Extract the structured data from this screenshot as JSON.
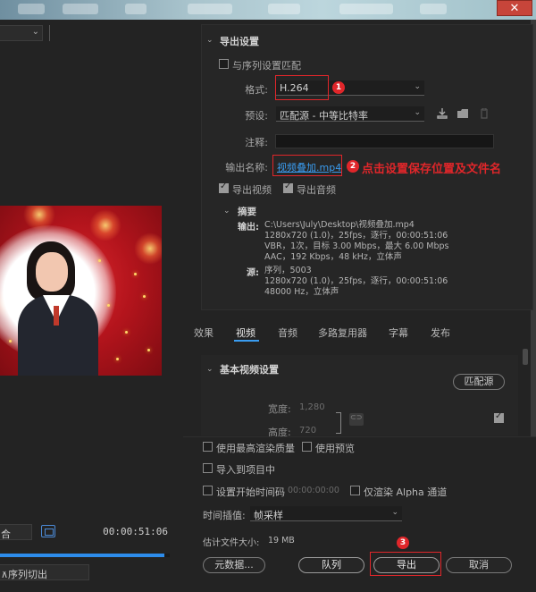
{
  "window": {
    "close_glyph": "✕"
  },
  "left_panel": {
    "fit_dropdown": "合",
    "timecode": "00:00:51:06",
    "progress_fraction": 0.97,
    "range_dropdown": "∧序列切出"
  },
  "export_settings": {
    "section_title": "导出设置",
    "match_sequence_label": "与序列设置匹配",
    "format_label": "格式:",
    "format_value": "H.264",
    "preset_label": "预设:",
    "preset_value": "匹配源 - 中等比特率",
    "comment_label": "注释:",
    "output_name_label": "输出名称:",
    "output_name_value": "视频叠加.mp4",
    "export_video_label": "导出视频",
    "export_audio_label": "导出音频"
  },
  "summary": {
    "title": "摘要",
    "output_key": "输出:",
    "output_lines": [
      "C:\\Users\\July\\Desktop\\视频叠加.mp4",
      "1280x720 (1.0)，25fps，逐行，00:00:51:06",
      "VBR，1次，目标 3.00 Mbps，最大 6.00 Mbps",
      "AAC，192 Kbps，48  kHz，立体声"
    ],
    "source_key": "源:",
    "source_lines": [
      "序列，5003",
      "1280x720 (1.0)，25fps，逐行，00:00:51:06",
      "48000 Hz，立体声"
    ]
  },
  "tabs": [
    "效果",
    "视频",
    "音频",
    "多路复用器",
    "字幕",
    "发布"
  ],
  "video": {
    "section_title": "基本视频设置",
    "match_source_button": "匹配源",
    "width_label": "宽度:",
    "width_value": "1,280",
    "height_label": "高度:",
    "height_value": "720"
  },
  "options": {
    "max_render_quality": "使用最高渲染质量",
    "use_previews": "使用预览",
    "import_into_project": "导入到项目中",
    "set_start_timecode": "设置开始时间码",
    "start_timecode_value": "00:00:00:00",
    "render_alpha_only": "仅渲染 Alpha 通道",
    "time_interpolation_label": "时间插值:",
    "time_interpolation_value": "帧采样",
    "estimated_size_label": "估计文件大小:",
    "estimated_size_value": "19 MB"
  },
  "buttons": {
    "metadata": "元数据...",
    "queue": "队列",
    "export": "导出",
    "cancel": "取消"
  },
  "annotations": {
    "badge_1": "1",
    "badge_2": "2",
    "badge_3": "3",
    "note_2": "点击设置保存位置及文件名",
    "color": "#e0262a"
  }
}
